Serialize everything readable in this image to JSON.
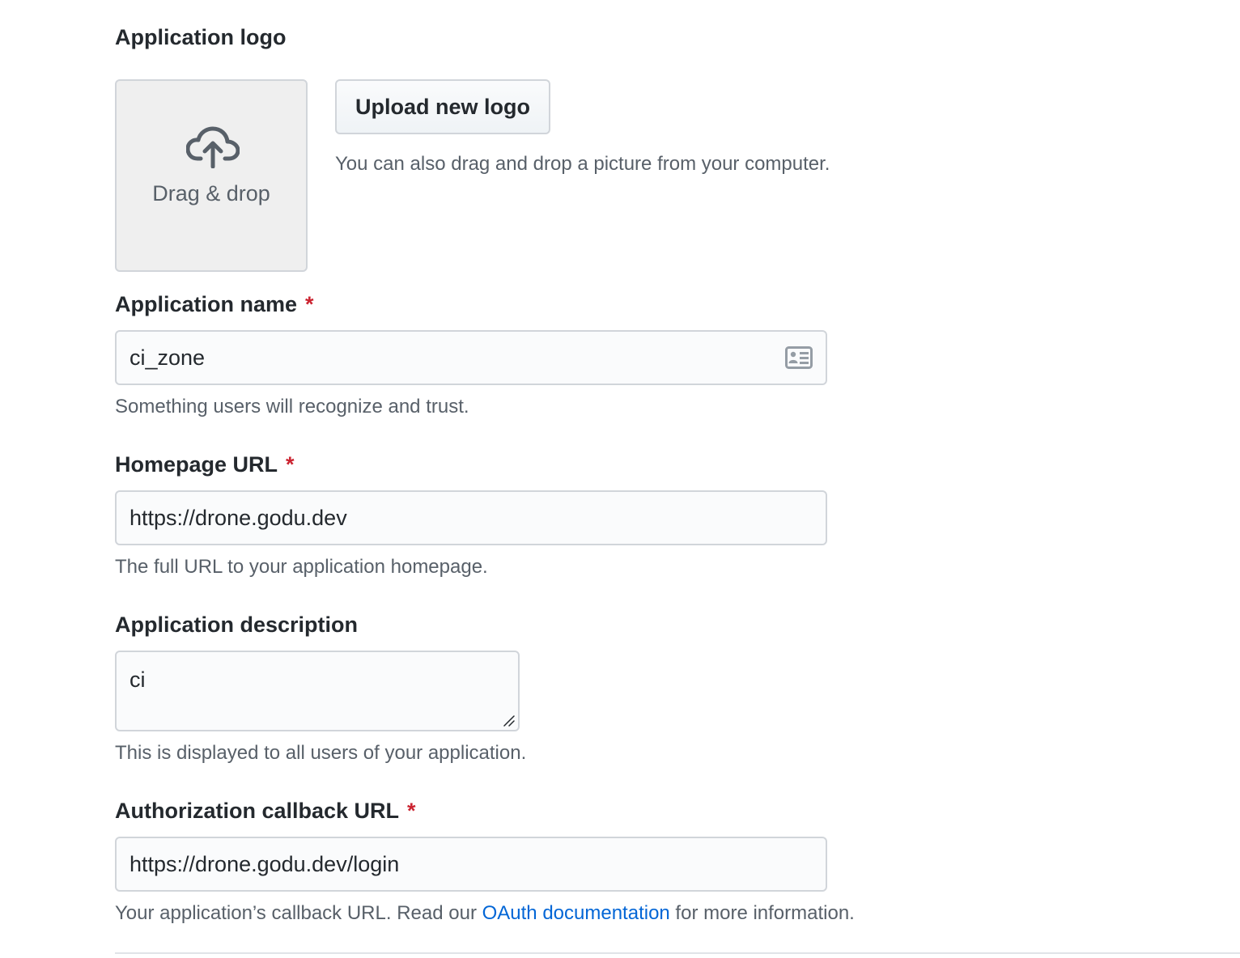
{
  "logo": {
    "label": "Application logo",
    "dropzone_text": "Drag & drop",
    "upload_button": "Upload new logo",
    "upload_note": "You can also drag and drop a picture from your computer."
  },
  "app_name": {
    "label": "Application name",
    "required": "*",
    "value": "ci_zone",
    "note": "Something users will recognize and trust."
  },
  "homepage": {
    "label": "Homepage URL",
    "required": "*",
    "value": "https://drone.godu.dev",
    "note": "The full URL to your application homepage."
  },
  "description": {
    "label": "Application description",
    "value": "ci",
    "note": "This is displayed to all users of your application."
  },
  "callback": {
    "label": "Authorization callback URL",
    "required": "*",
    "value": "https://drone.godu.dev/login",
    "note_before": "Your application’s callback URL. Read our ",
    "note_link": "OAuth documentation",
    "note_after": " for more information."
  },
  "icons": {
    "upload": "cloud-upload-icon",
    "autofill": "contact-card-icon",
    "resize": "resize-grip-icon"
  },
  "colors": {
    "text": "#24292e",
    "muted": "#586069",
    "required": "#cb2431",
    "link": "#0366d6",
    "border": "#d1d5da",
    "input_bg": "#fafbfc",
    "dropzone_bg": "#efefef"
  }
}
